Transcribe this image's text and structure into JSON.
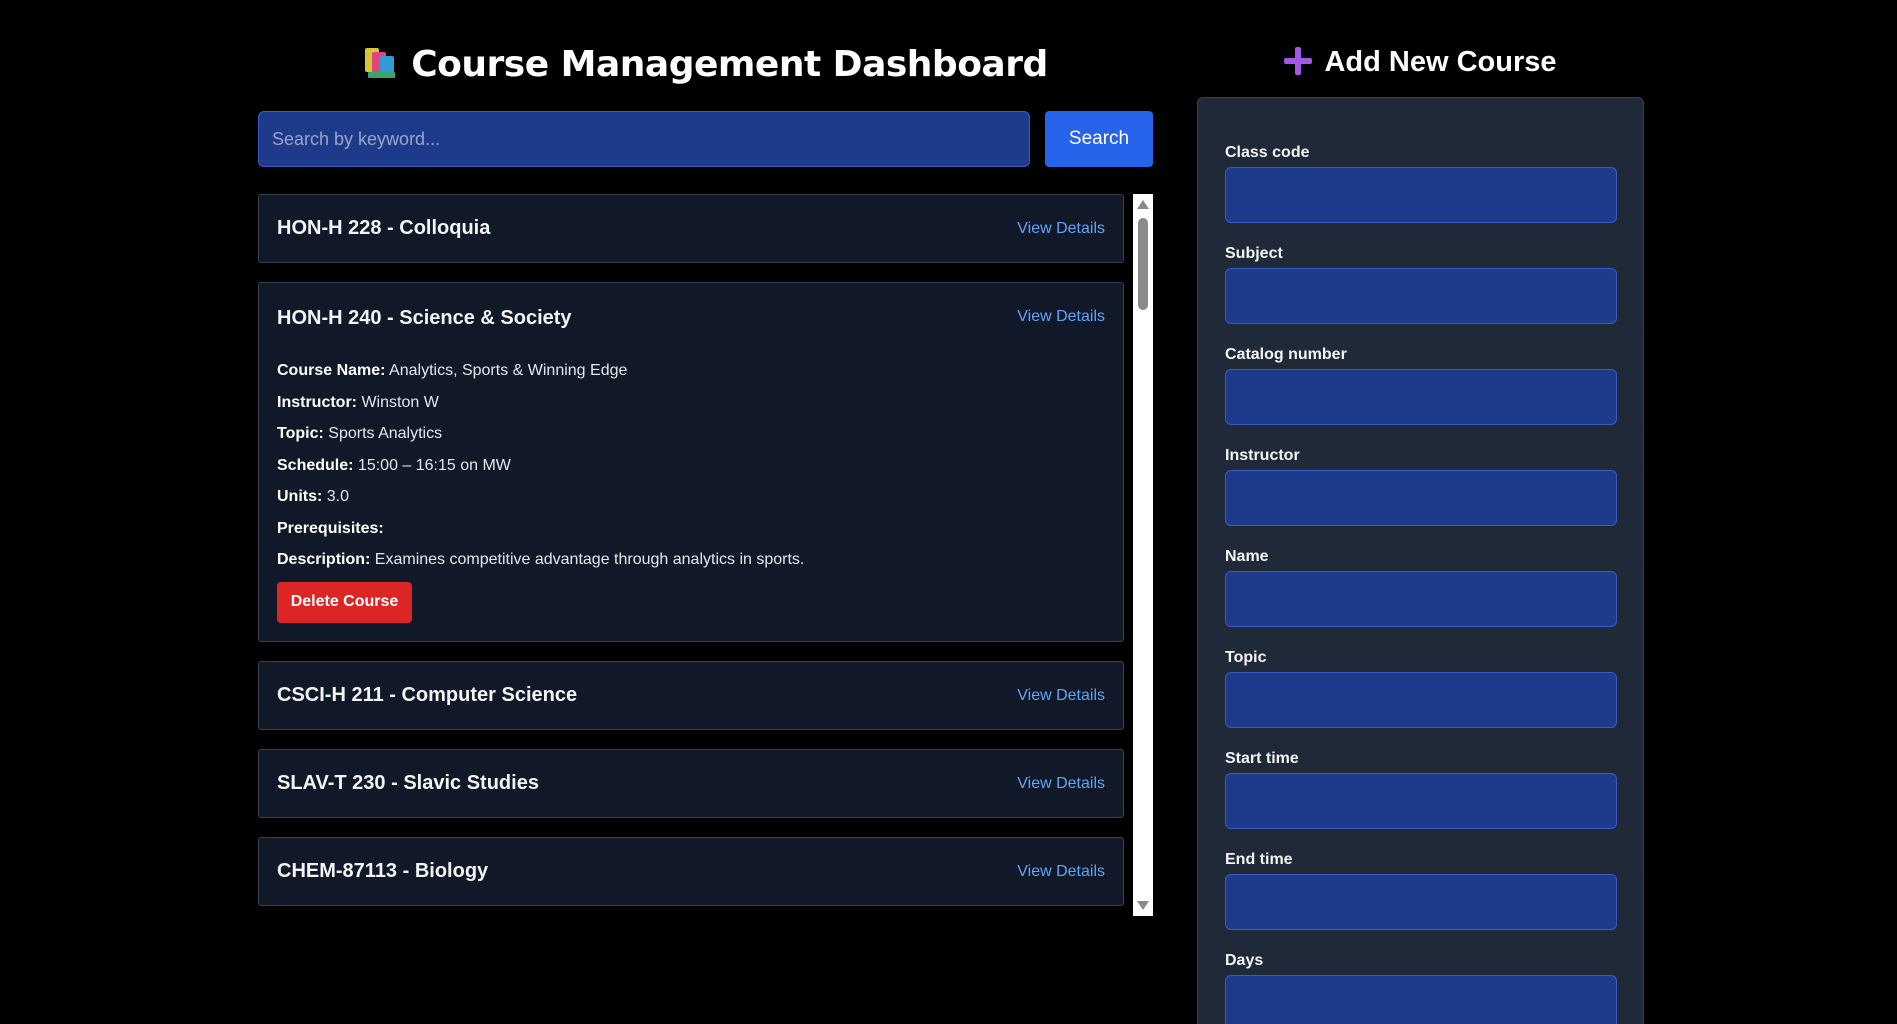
{
  "header": {
    "title": "Course Management Dashboard",
    "title_icon": "books-icon"
  },
  "search": {
    "placeholder": "Search by keyword...",
    "value": "",
    "button_label": "Search"
  },
  "courses": [
    {
      "title": "HON-H 228 - Colloquia",
      "action_label": "View Details",
      "expanded": false
    },
    {
      "title": "HON-H 240 - Science & Society",
      "action_label": "View Details",
      "expanded": true,
      "details": {
        "course_name_label": "Course Name:",
        "course_name": "Analytics, Sports & Winning Edge",
        "instructor_label": "Instructor:",
        "instructor": "Winston W",
        "topic_label": "Topic:",
        "topic": "Sports Analytics",
        "schedule_label": "Schedule:",
        "schedule": "15:00 – 16:15 on MW",
        "units_label": "Units:",
        "units": "3.0",
        "prerequisites_label": "Prerequisites:",
        "prerequisites": "",
        "description_label": "Description:",
        "description": "Examines competitive advantage through analytics in sports.",
        "delete_label": "Delete Course"
      }
    },
    {
      "title": "CSCI-H 211 - Computer Science",
      "action_label": "View Details",
      "expanded": false
    },
    {
      "title": "SLAV-T 230 - Slavic Studies",
      "action_label": "View Details",
      "expanded": false
    },
    {
      "title": "CHEM-87113 - Biology",
      "action_label": "View Details",
      "expanded": false
    }
  ],
  "add_form": {
    "title": "Add New Course",
    "title_icon": "plus-icon",
    "fields": [
      {
        "label": "Class code",
        "value": ""
      },
      {
        "label": "Subject",
        "value": ""
      },
      {
        "label": "Catalog number",
        "value": ""
      },
      {
        "label": "Instructor",
        "value": ""
      },
      {
        "label": "Name",
        "value": ""
      },
      {
        "label": "Topic",
        "value": ""
      },
      {
        "label": "Start time",
        "value": ""
      },
      {
        "label": "End time",
        "value": ""
      },
      {
        "label": "Days",
        "value": ""
      }
    ]
  },
  "colors": {
    "background": "#000000",
    "card_background": "#111827",
    "panel_background": "#1f2937",
    "input_background": "#1e3a8a",
    "primary_button": "#2563eb",
    "danger_button": "#dc2626",
    "link": "#60a5fa",
    "plus_icon": "#a259e6"
  }
}
